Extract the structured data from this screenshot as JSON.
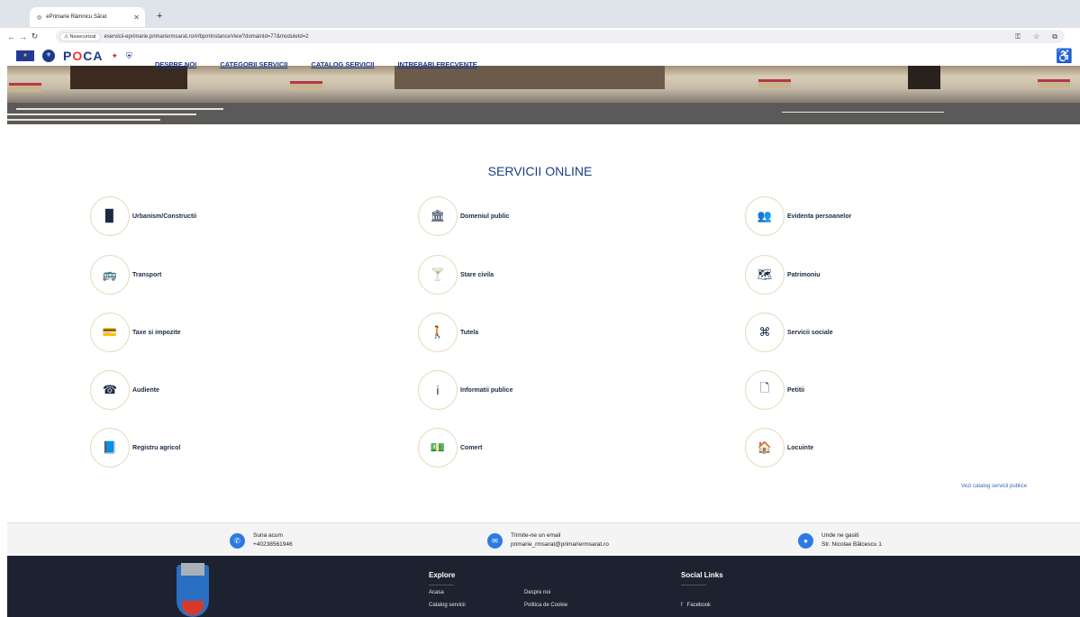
{
  "browser": {
    "tab_title": "ePrimarie Râmnicu Sărat",
    "new_tab": "+",
    "security_label": "Nesecurizat",
    "url": "eservicii-eprimarie.primariermsarat.ro/#/bpmInstanceView?domainId=77&moduleId=2"
  },
  "header": {
    "nav": [
      "DESPRE NOI",
      "CATEGORII SERVICII",
      "CATALOG SERVICII",
      "INTREBARI FRECVENTE"
    ],
    "logo_text": "POCA"
  },
  "main": {
    "title": "SERVICII ONLINE",
    "services": [
      {
        "label": "Urbanism/Constructii",
        "icon": "building-icon",
        "glyph": "▉"
      },
      {
        "label": "Domeniul public",
        "icon": "bank-icon",
        "glyph": "🏛"
      },
      {
        "label": "Evidenta persoanelor",
        "icon": "users-icon",
        "glyph": "👥"
      },
      {
        "label": "Transport",
        "icon": "bus-icon",
        "glyph": "🚌"
      },
      {
        "label": "Stare civila",
        "icon": "glass-icon",
        "glyph": "🍸"
      },
      {
        "label": "Patrimoniu",
        "icon": "map-icon",
        "glyph": "🗺"
      },
      {
        "label": "Taxe si impozite",
        "icon": "card-icon",
        "glyph": "💳"
      },
      {
        "label": "Tutela",
        "icon": "child-icon",
        "glyph": "🚶"
      },
      {
        "label": "Servicii sociale",
        "icon": "sitemap-icon",
        "glyph": "⌘"
      },
      {
        "label": "Audiente",
        "icon": "phone-icon",
        "glyph": "☎"
      },
      {
        "label": "Informatii publice",
        "icon": "info-icon",
        "glyph": "i"
      },
      {
        "label": "Petitii",
        "icon": "file-icon",
        "glyph": "🗋"
      },
      {
        "label": "Registru agricol",
        "icon": "book-icon",
        "glyph": "📘"
      },
      {
        "label": "Comert",
        "icon": "money-icon",
        "glyph": "💵"
      },
      {
        "label": "Locuinte",
        "icon": "home-icon",
        "glyph": "🏠"
      }
    ],
    "catalog_link": "Vezi catalog servicii publice"
  },
  "contact": {
    "phone_label": "Suna acum",
    "phone": "+40238561946",
    "email_label": "Trimite-ne un email",
    "email": "primarie_rmsarat@primariermsarat.ro",
    "address_label": "Unde ne gasiti",
    "address": "Str. Nicolae Bălcescu 1"
  },
  "footer": {
    "explore_title": "Explore",
    "explore_links": [
      "Acasa",
      "Despre noi",
      "Catalog servicii",
      "Politica de Cookie"
    ],
    "social_title": "Social Links",
    "social_links": [
      "Facebook"
    ]
  },
  "colors": {
    "accent": "#1b3f86",
    "contact_icon": "#2c7be5",
    "footer_bg": "#1c2230"
  }
}
